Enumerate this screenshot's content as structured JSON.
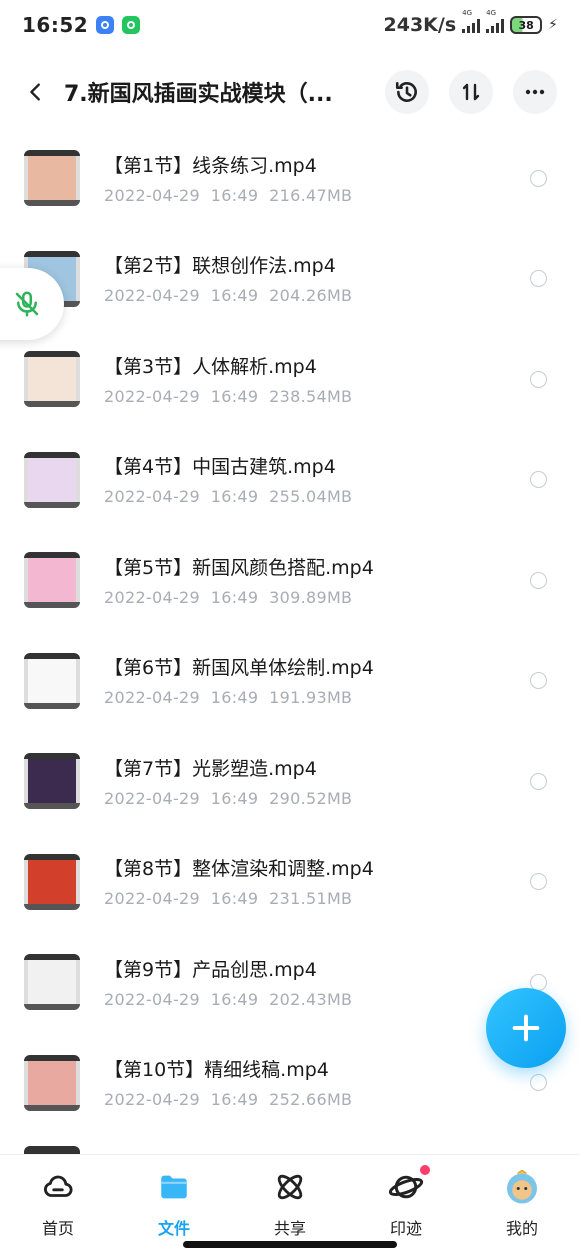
{
  "status_bar": {
    "time": "16:52",
    "speed": "243K/s",
    "network_1": "4G",
    "network_2": "4G",
    "battery": "38"
  },
  "header": {
    "title": "7.新国风插画实战模块（...",
    "back_icon": "chevron-left-icon",
    "history_icon": "history-icon",
    "sort_icon": "sort-icon",
    "more_icon": "more-icon"
  },
  "files": [
    {
      "name": "【第1节】线条练习.mp4",
      "date": "2022-04-29",
      "time": "16:49",
      "size": "216.47MB",
      "thumb": "#e8b9a0"
    },
    {
      "name": "【第2节】联想创作法.mp4",
      "date": "2022-04-29",
      "time": "16:49",
      "size": "204.26MB",
      "thumb": "#9fc5e0"
    },
    {
      "name": "【第3节】人体解析.mp4",
      "date": "2022-04-29",
      "time": "16:49",
      "size": "238.54MB",
      "thumb": "#f4e4d8"
    },
    {
      "name": "【第4节】中国古建筑.mp4",
      "date": "2022-04-29",
      "time": "16:49",
      "size": "255.04MB",
      "thumb": "#e9d6ef"
    },
    {
      "name": "【第5节】新国风颜色搭配.mp4",
      "date": "2022-04-29",
      "time": "16:49",
      "size": "309.89MB",
      "thumb": "#f3b7d2"
    },
    {
      "name": "【第6节】新国风单体绘制.mp4",
      "date": "2022-04-29",
      "time": "16:49",
      "size": "191.93MB",
      "thumb": "#f8f8f8"
    },
    {
      "name": "【第7节】光影塑造.mp4",
      "date": "2022-04-29",
      "time": "16:49",
      "size": "290.52MB",
      "thumb": "#3d2a4f"
    },
    {
      "name": "【第8节】整体渲染和调整.mp4",
      "date": "2022-04-29",
      "time": "16:49",
      "size": "231.51MB",
      "thumb": "#d2402b"
    },
    {
      "name": "【第9节】产品创思.mp4",
      "date": "2022-04-29",
      "time": "16:49",
      "size": "202.43MB",
      "thumb": "#f1f1f1"
    },
    {
      "name": "【第10节】精细线稿.mp4",
      "date": "2022-04-29",
      "time": "16:49",
      "size": "252.66MB",
      "thumb": "#e7a9a0"
    }
  ],
  "fab": {
    "icon": "plus-icon"
  },
  "nav": {
    "home": "首页",
    "files": "文件",
    "share": "共享",
    "moments": "印迹",
    "mine": "我的"
  },
  "colors": {
    "accent": "#1aa3f0",
    "meta_text": "#a8adb5",
    "badge": "#ff3d6b"
  }
}
